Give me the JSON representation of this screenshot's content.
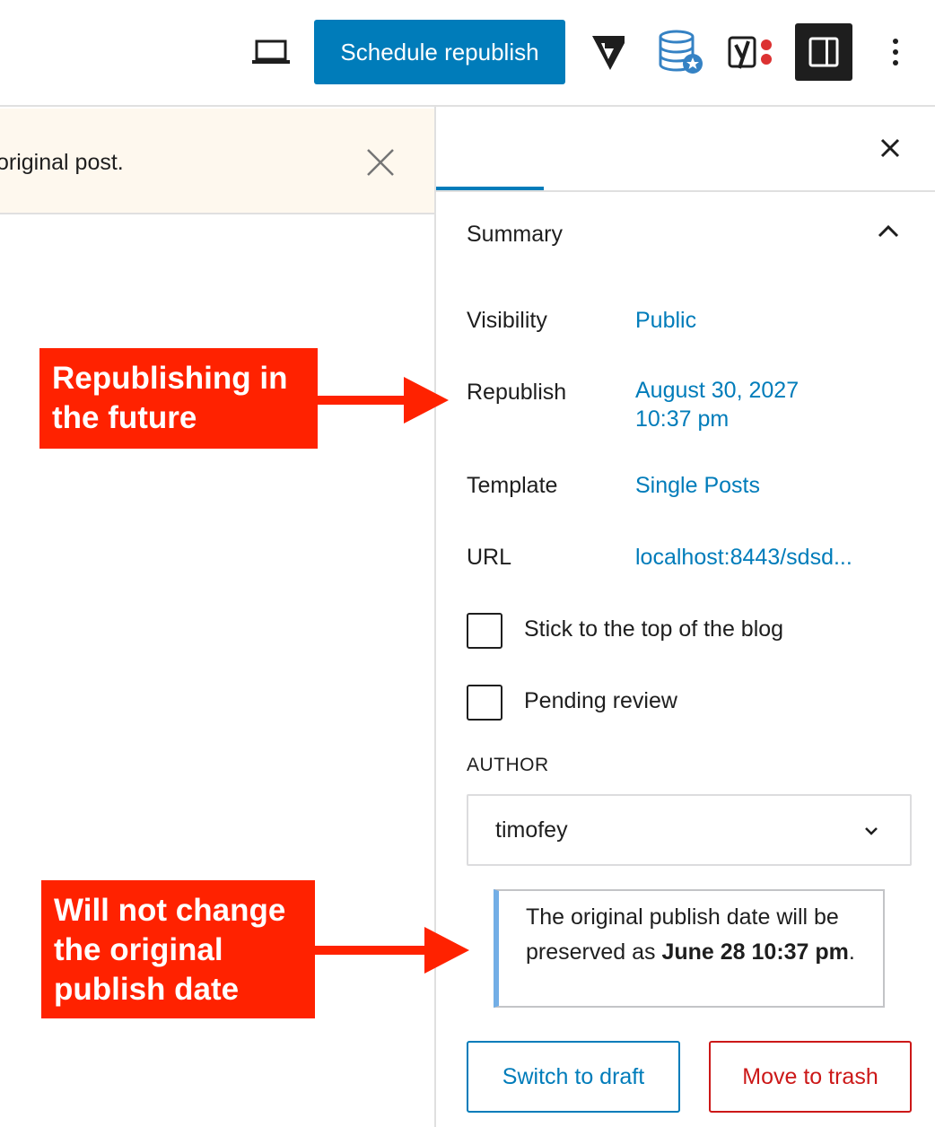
{
  "toolbar": {
    "schedule_label": "Schedule republish",
    "icons": [
      "laptop-icon",
      "g-icon",
      "database-star-icon",
      "yoast-icon",
      "sidebar-toggle-icon",
      "more-vertical-icon"
    ]
  },
  "notice": {
    "text": "original post."
  },
  "sidebar": {
    "summary_title": "Summary",
    "rows": {
      "visibility": {
        "label": "Visibility",
        "value": "Public"
      },
      "republish": {
        "label": "Republish",
        "date": "August 30, 2027",
        "time": "10:37 pm"
      },
      "template": {
        "label": "Template",
        "value": "Single Posts"
      },
      "url": {
        "label": "URL",
        "value": "localhost:8443/sdsd..."
      }
    },
    "checkboxes": {
      "sticky": "Stick to the top of the blog",
      "pending": "Pending review"
    },
    "author": {
      "heading": "AUTHOR",
      "value": "timofey"
    },
    "info": {
      "prefix": "The original publish date will be preserved as ",
      "date": "June 28 10:37 pm",
      "suffix": "."
    },
    "buttons": {
      "draft": "Switch to draft",
      "trash": "Move to trash"
    }
  },
  "annotations": {
    "first": "Republishing in the future",
    "second": "Will not change the original publish date"
  },
  "colors": {
    "accent": "#007cba",
    "danger": "#cc1818",
    "annotation": "#ff2200",
    "notice_bg": "#fef8ee",
    "info_border": "#72aee6"
  }
}
